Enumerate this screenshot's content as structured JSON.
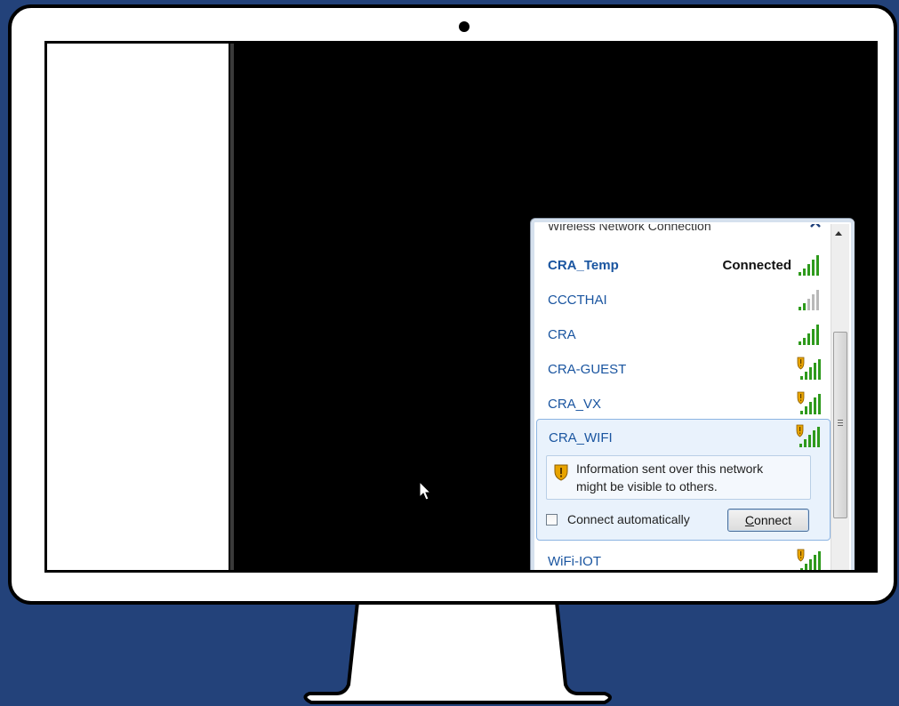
{
  "flyout": {
    "section_header": "Wireless Network Connection",
    "networks": [
      {
        "name": "CRA_Temp",
        "status": "Connected",
        "secured": false,
        "signal_bars": 5
      },
      {
        "name": "CCCTHAI",
        "status": "",
        "secured": false,
        "signal_bars": 2
      },
      {
        "name": "CRA",
        "status": "",
        "secured": false,
        "signal_bars": 5
      },
      {
        "name": "CRA-GUEST",
        "status": "",
        "secured": true,
        "signal_bars": 5
      },
      {
        "name": "CRA_VX",
        "status": "",
        "secured": true,
        "signal_bars": 5
      },
      {
        "name": "WiFi-IOT",
        "status": "",
        "secured": true,
        "signal_bars": 5
      }
    ],
    "selected": {
      "name": "CRA_WIFI",
      "secured": true,
      "signal_bars": 5,
      "info_line1": "Information sent over this network",
      "info_line2": "might be visible to others.",
      "auto_connect_label": "Connect automatically",
      "auto_connect_checked": false,
      "connect_button_underlined": "C",
      "connect_button_rest": "onnect"
    }
  },
  "colors": {
    "background": "#23427a",
    "network_name": "#1a55a0",
    "selection_fill": "#e9f2fc",
    "signal_green": "#2e9a1c"
  }
}
